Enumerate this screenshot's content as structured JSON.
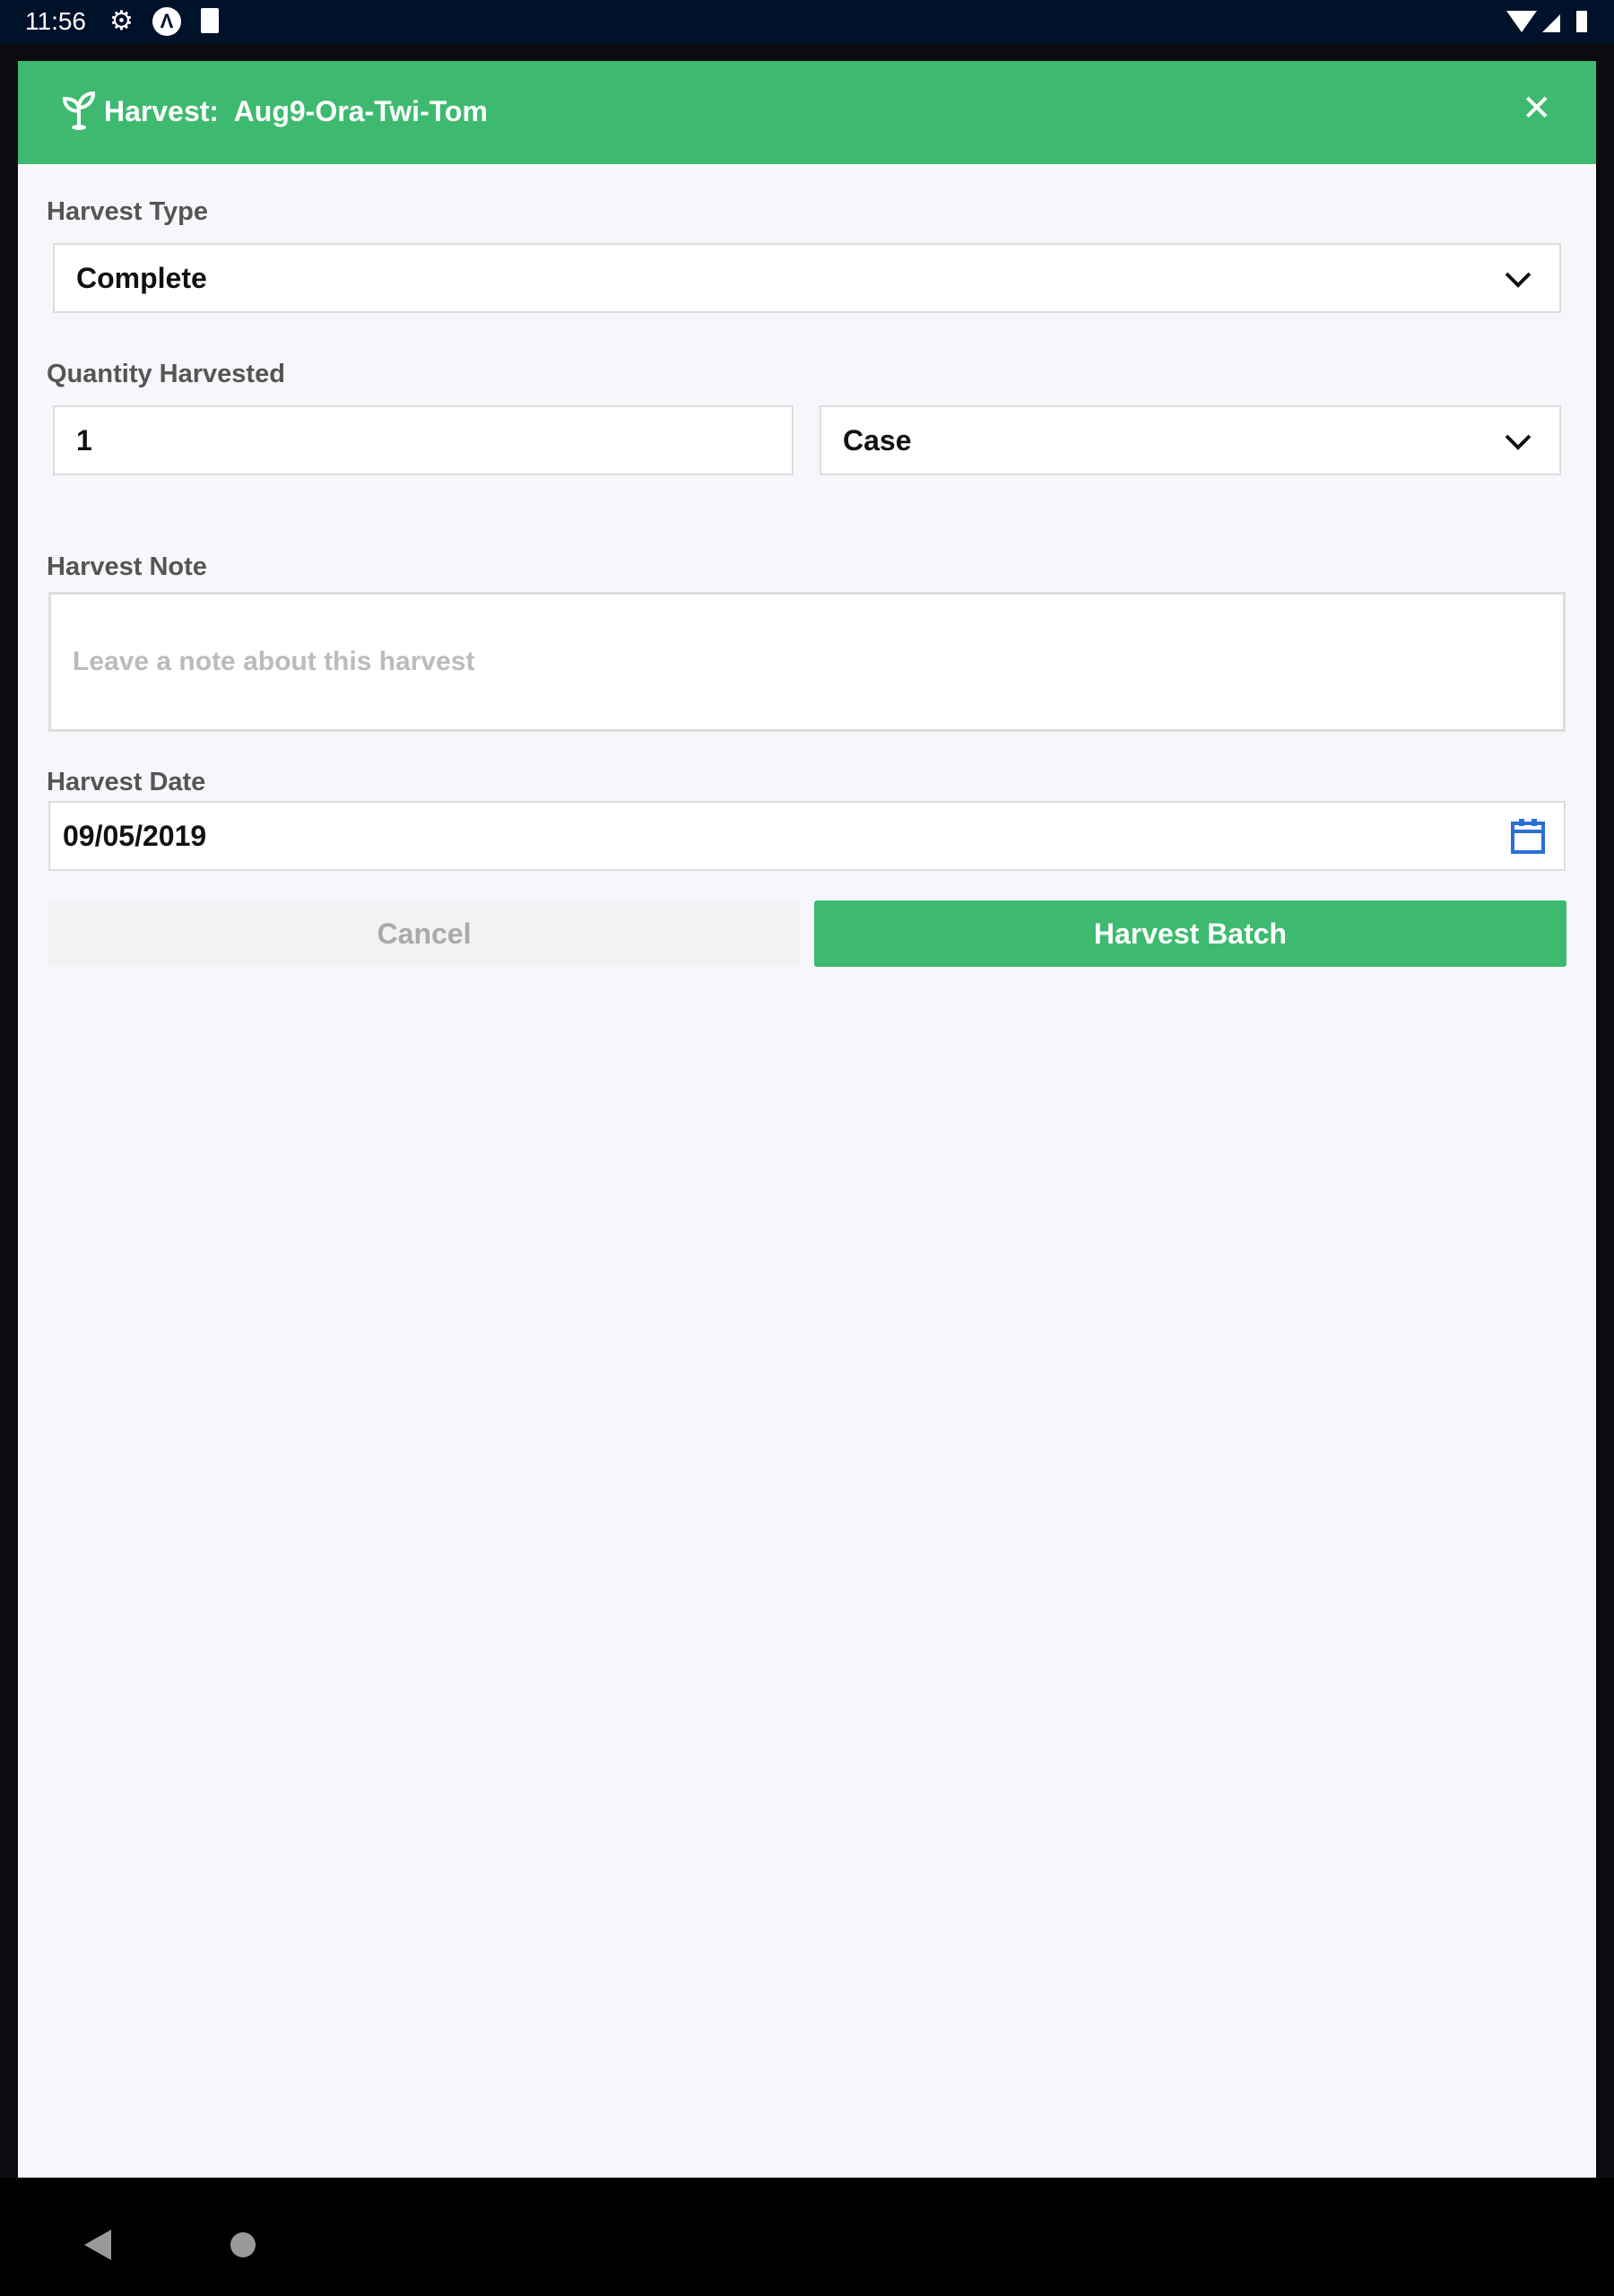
{
  "status_bar": {
    "time": "11:56",
    "icons": [
      "gear-icon",
      "a-icon",
      "sd-card-icon",
      "wifi-icon",
      "signal-icon",
      "battery-icon"
    ]
  },
  "modal": {
    "title": "Harvest:  Aug9-Ora-Twi-Tom",
    "title_icon": "seedling-icon",
    "accent_color": "#3dba6f",
    "harvest_type": {
      "label": "Harvest Type",
      "value": "Complete"
    },
    "quantity": {
      "label": "Quantity Harvested",
      "value": "1",
      "unit": "Case"
    },
    "note": {
      "label": "Harvest Note",
      "placeholder": "Leave a note about this harvest",
      "value": ""
    },
    "date": {
      "label": "Harvest Date",
      "value": "09/05/2019"
    },
    "cancel_label": "Cancel",
    "submit_label": "Harvest Batch"
  }
}
